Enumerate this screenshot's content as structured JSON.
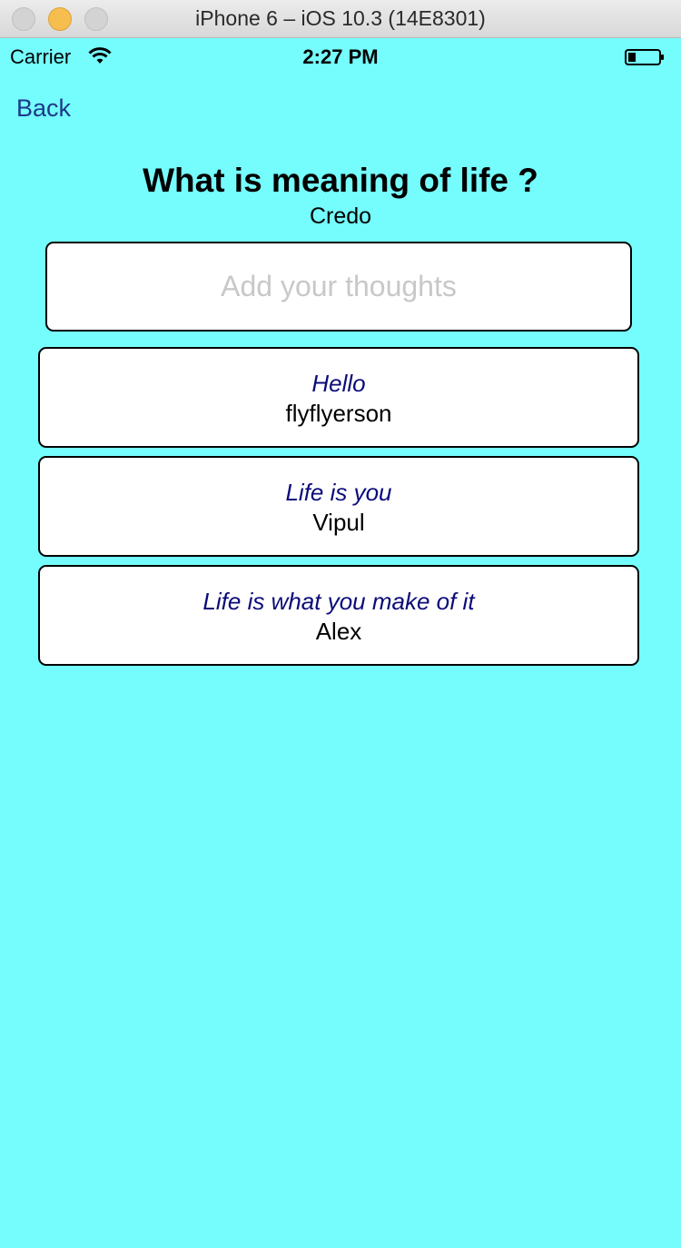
{
  "window": {
    "title": "iPhone 6 – iOS 10.3 (14E8301)"
  },
  "status_bar": {
    "carrier": "Carrier",
    "time": "2:27 PM",
    "wifi_icon": "wifi-icon",
    "battery_icon": "battery-icon"
  },
  "nav": {
    "back_label": "Back"
  },
  "question": {
    "title": "What is meaning of life ?",
    "asker": "Credo"
  },
  "input": {
    "placeholder": "Add your thoughts",
    "value": ""
  },
  "answers": [
    {
      "text": "Hello",
      "author": "flyflyerson"
    },
    {
      "text": "Life is you",
      "author": "Vipul"
    },
    {
      "text": "Life is what you make of it",
      "author": "Alex"
    }
  ],
  "colors": {
    "background": "#75fcfd",
    "link": "#1d3a8a",
    "answer_text": "#0b0b7a",
    "minimize_button": "#f6be4f"
  }
}
